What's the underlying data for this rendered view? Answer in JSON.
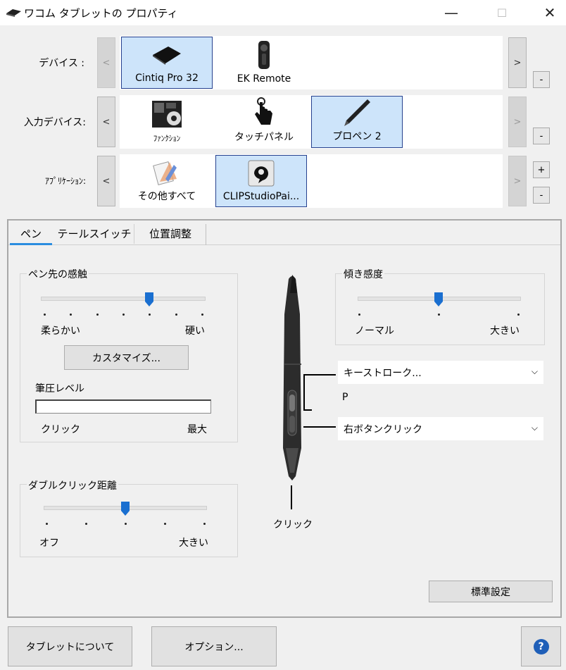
{
  "window": {
    "title": "ワコム タブレットの プロパティ",
    "minimize": "—",
    "maximize": "☐",
    "close": "✕"
  },
  "rows": {
    "device": {
      "label": "デバイス :",
      "nav_left": "<",
      "nav_right": ">",
      "items": [
        {
          "label": "Cintiq Pro 32",
          "icon": "tablet-icon",
          "selected": true
        },
        {
          "label": "EK Remote",
          "icon": "remote-icon",
          "selected": false
        }
      ],
      "remove": "-"
    },
    "input": {
      "label": "入力デバイス:",
      "nav_left": "<",
      "nav_right": ">",
      "items": [
        {
          "label": "ﾌｧﾝｸｼｮﾝ",
          "icon": "function-keys-icon",
          "selected": false
        },
        {
          "label": "タッチパネル",
          "icon": "touch-hand-icon",
          "selected": false
        },
        {
          "label": "プロペン 2",
          "icon": "pen-icon",
          "selected": true
        }
      ],
      "remove": "-"
    },
    "app": {
      "label": "ｱﾌﾟﾘｹｰｼｮﾝ:",
      "nav_left": "<",
      "nav_right": ">",
      "items": [
        {
          "label": "その他すべて",
          "icon": "all-apps-icon",
          "selected": false
        },
        {
          "label": "CLIPStudioPai...",
          "icon": "clip-studio-icon",
          "selected": true
        }
      ],
      "add": "+",
      "remove": "-"
    }
  },
  "tabs": [
    {
      "label": "ペン",
      "active": true
    },
    {
      "label": "テールスイッチ",
      "active": false
    },
    {
      "label": "位置調整",
      "active": false
    }
  ],
  "pen_tab": {
    "tip_feel": {
      "title": "ペン先の感触",
      "min_label": "柔らかい",
      "max_label": "硬い",
      "level": 4,
      "steps": 7,
      "customize": "カスタマイズ...",
      "pressure_label": "筆圧レベル",
      "pressure_value": 0,
      "click_label": "クリック",
      "max_value_label": "最大"
    },
    "double_click": {
      "title": "ダブルクリック距離",
      "min_label": "オフ",
      "max_label": "大きい",
      "level": 2,
      "steps": 5
    },
    "tilt": {
      "title": "傾き感度",
      "min_label": "ノーマル",
      "max_label": "大きい",
      "level": 1,
      "steps": 3
    },
    "upper_button": {
      "value": "キーストローク...",
      "detail": "P"
    },
    "lower_button": {
      "value": "右ボタンクリック"
    },
    "tip_action": "クリック",
    "defaults": "標準設定"
  },
  "footer": {
    "about": "タブレットについて",
    "options": "オプション...",
    "help": "?"
  },
  "colors": {
    "accent": "#2b8de0",
    "selected_bg": "#cde4fa",
    "selected_border": "#26418f",
    "slider_thumb": "#1a6fd0"
  }
}
